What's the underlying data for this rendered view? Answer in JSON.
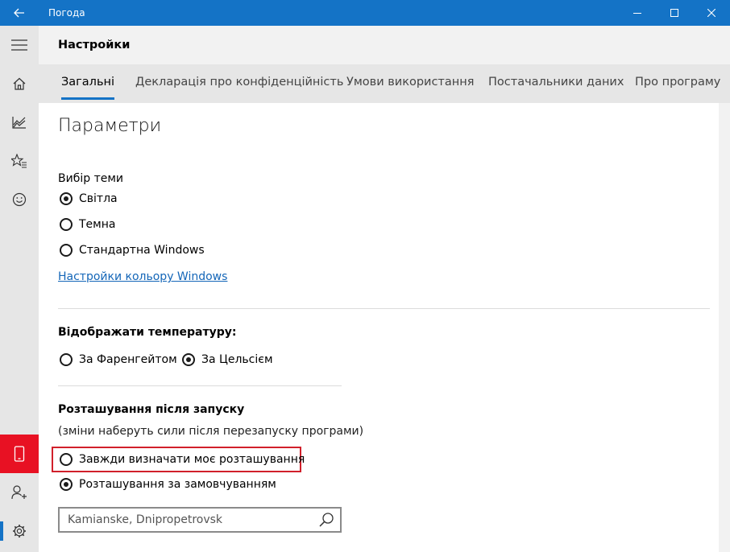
{
  "window": {
    "title": "Погода",
    "accent_color": "#1473c6",
    "controls": [
      "back-icon",
      "minimize-icon",
      "maximize-icon",
      "close-icon"
    ]
  },
  "sidebar": {
    "items": [
      {
        "name": "hamburger-menu",
        "icon": "hamburger-icon"
      },
      {
        "name": "home",
        "icon": "home-icon"
      },
      {
        "name": "historical-weather",
        "icon": "chart-icon"
      },
      {
        "name": "places",
        "icon": "favorites-icon"
      },
      {
        "name": "news",
        "icon": "smiley-icon"
      },
      {
        "name": "mobile",
        "icon": "phone-icon",
        "active_color": "#e81123"
      },
      {
        "name": "sign-in",
        "icon": "person-add-icon"
      },
      {
        "name": "settings",
        "icon": "gear-icon",
        "selected": true
      }
    ]
  },
  "header": {
    "title": "Настройки"
  },
  "tabs": [
    {
      "label": "Загальні",
      "active": true
    },
    {
      "label": "Декларація про конфіденційність"
    },
    {
      "label": "Умови використання"
    },
    {
      "label": "Постачальники даних"
    },
    {
      "label": "Про програму"
    }
  ],
  "settings": {
    "title": "Параметри",
    "theme": {
      "label": "Вибір теми",
      "options": [
        {
          "label": "Світла",
          "checked": true
        },
        {
          "label": "Темна",
          "checked": false
        },
        {
          "label": "Стандартна Windows",
          "checked": false
        }
      ],
      "link": "Настройки кольору Windows"
    },
    "temperature": {
      "label": "Відображати температуру:",
      "options": [
        {
          "label": "За Фаренгейтом",
          "checked": false
        },
        {
          "label": "За Цельсієм",
          "checked": true
        }
      ]
    },
    "location": {
      "label": "Розташування після запуску",
      "note": "(зміни наберуть сили після перезапуску програми)",
      "options": [
        {
          "label": "Завжди визначати моє розташування",
          "checked": false,
          "highlighted": true
        },
        {
          "label": "Розташування за замовчуванням",
          "checked": true
        }
      ],
      "search_value": "Kamianske, Dnipropetrovsk",
      "search_icon": "search-icon",
      "highlight_color": "#d1202b"
    }
  }
}
